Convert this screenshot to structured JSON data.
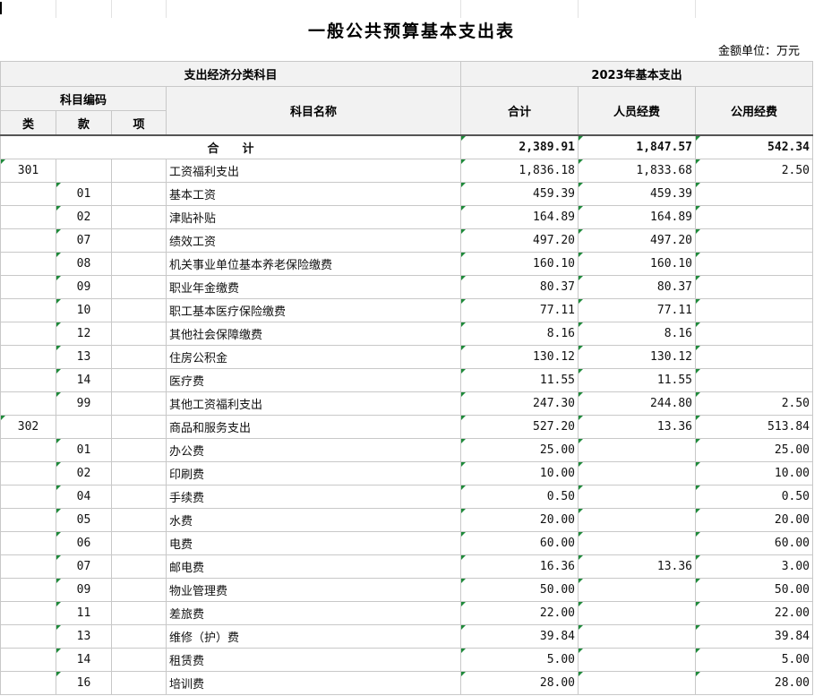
{
  "title": "一般公共预算基本支出表",
  "unit": "金额单位：万元",
  "header": {
    "group_left": "支出经济分类科目",
    "group_right": "2023年基本支出",
    "code_group": "科目编码",
    "col_lei": "类",
    "col_kuan": "款",
    "col_xiang": "项",
    "col_name": "科目名称",
    "col_total": "合计",
    "col_personnel": "人员经费",
    "col_public": "公用经费"
  },
  "total": {
    "label": "合　　计",
    "total": "2,389.91",
    "personnel": "1,847.57",
    "public": "542.34"
  },
  "rows": [
    {
      "lei": "301",
      "kuan": "",
      "xiang": "",
      "name": "工资福利支出",
      "total": "1,836.18",
      "personnel": "1,833.68",
      "public": "2.50"
    },
    {
      "lei": "",
      "kuan": "01",
      "xiang": "",
      "name": "基本工资",
      "total": "459.39",
      "personnel": "459.39",
      "public": ""
    },
    {
      "lei": "",
      "kuan": "02",
      "xiang": "",
      "name": "津贴补贴",
      "total": "164.89",
      "personnel": "164.89",
      "public": ""
    },
    {
      "lei": "",
      "kuan": "07",
      "xiang": "",
      "name": "绩效工资",
      "total": "497.20",
      "personnel": "497.20",
      "public": ""
    },
    {
      "lei": "",
      "kuan": "08",
      "xiang": "",
      "name": "机关事业单位基本养老保险缴费",
      "total": "160.10",
      "personnel": "160.10",
      "public": ""
    },
    {
      "lei": "",
      "kuan": "09",
      "xiang": "",
      "name": "职业年金缴费",
      "total": "80.37",
      "personnel": "80.37",
      "public": ""
    },
    {
      "lei": "",
      "kuan": "10",
      "xiang": "",
      "name": "职工基本医疗保险缴费",
      "total": "77.11",
      "personnel": "77.11",
      "public": ""
    },
    {
      "lei": "",
      "kuan": "12",
      "xiang": "",
      "name": "其他社会保障缴费",
      "total": "8.16",
      "personnel": "8.16",
      "public": ""
    },
    {
      "lei": "",
      "kuan": "13",
      "xiang": "",
      "name": "住房公积金",
      "total": "130.12",
      "personnel": "130.12",
      "public": ""
    },
    {
      "lei": "",
      "kuan": "14",
      "xiang": "",
      "name": "医疗费",
      "total": "11.55",
      "personnel": "11.55",
      "public": ""
    },
    {
      "lei": "",
      "kuan": "99",
      "xiang": "",
      "name": "其他工资福利支出",
      "total": "247.30",
      "personnel": "244.80",
      "public": "2.50"
    },
    {
      "lei": "302",
      "kuan": "",
      "xiang": "",
      "name": "商品和服务支出",
      "total": "527.20",
      "personnel": "13.36",
      "public": "513.84"
    },
    {
      "lei": "",
      "kuan": "01",
      "xiang": "",
      "name": "办公费",
      "total": "25.00",
      "personnel": "",
      "public": "25.00"
    },
    {
      "lei": "",
      "kuan": "02",
      "xiang": "",
      "name": "印刷费",
      "total": "10.00",
      "personnel": "",
      "public": "10.00"
    },
    {
      "lei": "",
      "kuan": "04",
      "xiang": "",
      "name": "手续费",
      "total": "0.50",
      "personnel": "",
      "public": "0.50"
    },
    {
      "lei": "",
      "kuan": "05",
      "xiang": "",
      "name": "水费",
      "total": "20.00",
      "personnel": "",
      "public": "20.00"
    },
    {
      "lei": "",
      "kuan": "06",
      "xiang": "",
      "name": "电费",
      "total": "60.00",
      "personnel": "",
      "public": "60.00"
    },
    {
      "lei": "",
      "kuan": "07",
      "xiang": "",
      "name": "邮电费",
      "total": "16.36",
      "personnel": "13.36",
      "public": "3.00"
    },
    {
      "lei": "",
      "kuan": "09",
      "xiang": "",
      "name": "物业管理费",
      "total": "50.00",
      "personnel": "",
      "public": "50.00"
    },
    {
      "lei": "",
      "kuan": "11",
      "xiang": "",
      "name": "差旅费",
      "total": "22.00",
      "personnel": "",
      "public": "22.00"
    },
    {
      "lei": "",
      "kuan": "13",
      "xiang": "",
      "name": "维修（护）费",
      "total": "39.84",
      "personnel": "",
      "public": "39.84"
    },
    {
      "lei": "",
      "kuan": "14",
      "xiang": "",
      "name": "租赁费",
      "total": "5.00",
      "personnel": "",
      "public": "5.00"
    },
    {
      "lei": "",
      "kuan": "16",
      "xiang": "",
      "name": "培训费",
      "total": "28.00",
      "personnel": "",
      "public": "28.00"
    }
  ]
}
